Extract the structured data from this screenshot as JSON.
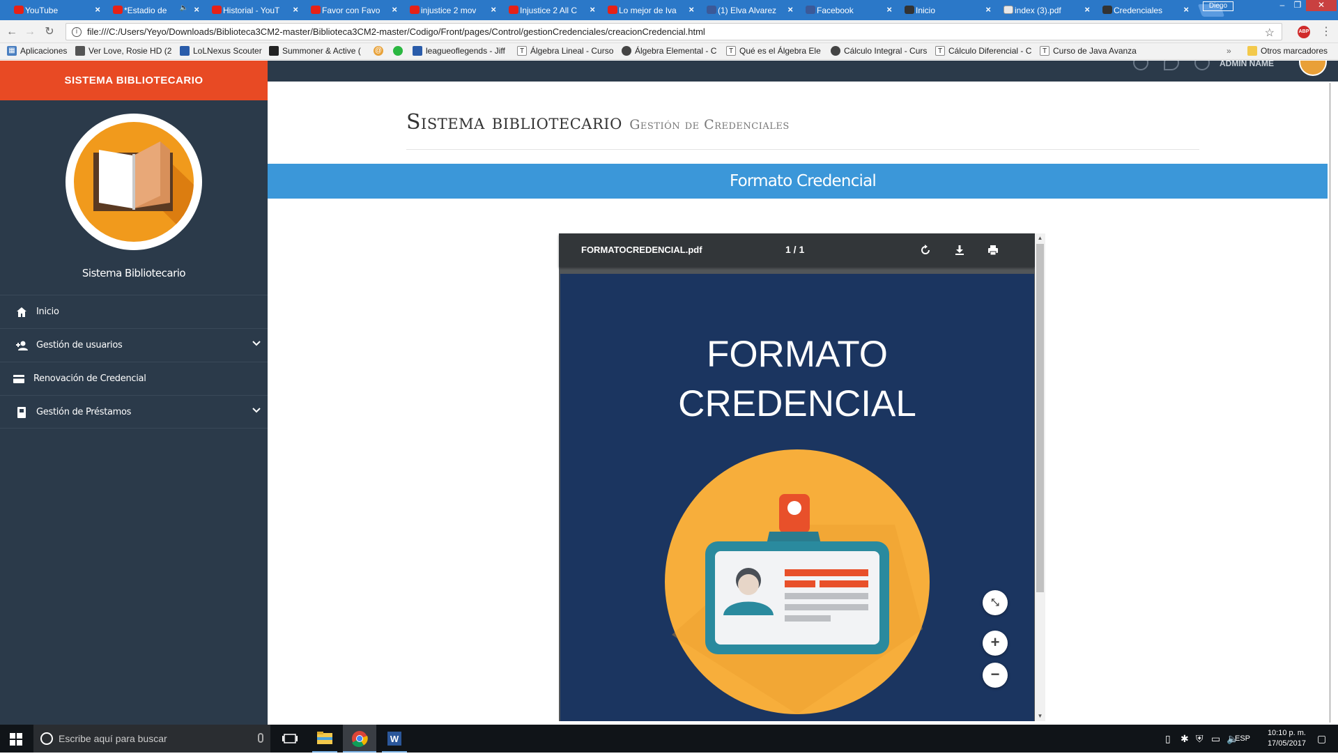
{
  "browser": {
    "tabs": [
      {
        "label": "YouTube",
        "favicon": "youtube-icon",
        "active": false
      },
      {
        "label": "*Estadio de",
        "favicon": "youtube-icon",
        "active": false,
        "audio": "🔈"
      },
      {
        "label": "Historial - YouT",
        "favicon": "youtube-icon",
        "active": false
      },
      {
        "label": "Favor con Favo",
        "favicon": "youtube-icon",
        "active": false
      },
      {
        "label": "injustice 2 mov",
        "favicon": "youtube-icon",
        "active": false
      },
      {
        "label": "Injustice 2 All C",
        "favicon": "youtube-icon",
        "active": false
      },
      {
        "label": "Lo mejor de Iva",
        "favicon": "youtube-icon",
        "active": false
      },
      {
        "label": "(1) Elva Alvarez",
        "favicon": "facebook-icon",
        "active": false
      },
      {
        "label": "Facebook",
        "favicon": "facebook-icon",
        "active": false
      },
      {
        "label": "Inicio",
        "favicon": "page-icon",
        "active": false
      },
      {
        "label": "index (3).pdf",
        "favicon": "file-icon",
        "active": false
      },
      {
        "label": "Credenciales",
        "favicon": "page-icon",
        "active": true
      }
    ],
    "profile_name": "Diego",
    "close_glyph": "×",
    "url": "file:///C:/Users/Yeyo/Downloads/Biblioteca3CM2-master/Biblioteca3CM2-master/Codigo/Front/pages/Control/gestionCredenciales/creacionCredencial.html",
    "abp_label": "ABP",
    "bookmarks": [
      {
        "label": "Aplicaciones",
        "icon": "apps-grid-icon"
      },
      {
        "label": "Ver Love, Rosie HD (2(",
        "icon": "film-icon"
      },
      {
        "label": "LoLNexus Scouter",
        "icon": "lolnexus-icon"
      },
      {
        "label": "Summoner & Active (",
        "icon": "summoner-icon"
      },
      {
        "label": "",
        "icon": "at-icon"
      },
      {
        "label": "",
        "icon": "whatsapp-icon"
      },
      {
        "label": "leagueoflegends - Jiff",
        "icon": "lol-icon"
      },
      {
        "label": "Álgebra Lineal - Curso",
        "icon": "t-icon"
      },
      {
        "label": "Álgebra Elemental - C",
        "icon": "profile-icon"
      },
      {
        "label": "Qué es el Álgebra Ele",
        "icon": "t-icon"
      },
      {
        "label": "Cálculo Integral - Curs",
        "icon": "profile-icon"
      },
      {
        "label": "Cálculo Diferencial - C",
        "icon": "t-icon"
      },
      {
        "label": "Curso de Java Avanza",
        "icon": "t-icon"
      }
    ],
    "more_bookmarks": "»",
    "other_bookmarks": "Otros marcadores"
  },
  "sidebar": {
    "header": "SISTEMA BIBLIOTECARIO",
    "site_name": "Sistema Bibliotecario",
    "items": [
      {
        "label": "Inicio",
        "icon": "home-icon",
        "has_submenu": false
      },
      {
        "label": "Gestión de usuarios",
        "icon": "add-user-icon",
        "has_submenu": true
      },
      {
        "label": "Renovación de Credencial",
        "icon": "credit-card-icon",
        "has_submenu": false
      },
      {
        "label": "Gestión de Préstamos",
        "icon": "book-icon",
        "has_submenu": true
      }
    ]
  },
  "topnav": {
    "admin_name": "ADMIN NAME"
  },
  "main": {
    "title": "Sistema bibliotecario",
    "subtitle": "Gestión de Credenciales",
    "banner": "Formato Credencial"
  },
  "pdf_viewer": {
    "filename": "FORMATOCREDENCIAL.pdf",
    "page_indicator": "1 / 1",
    "heading_line1": "FORMATO",
    "heading_line2": "CREDENCIAL"
  },
  "taskbar": {
    "search_placeholder": "Escribe aquí para buscar",
    "language": "ESP",
    "time": "10:10 p. m.",
    "date": "17/05/2017"
  },
  "colors": {
    "sidebar_bg": "#2b3a4a",
    "sidebar_header": "#e84a24",
    "banner": "#3b97d9",
    "pdf_page": "#1b3560",
    "badge_circle": "#f7ae3b",
    "chrome_tabstrip": "#2b78c8"
  }
}
